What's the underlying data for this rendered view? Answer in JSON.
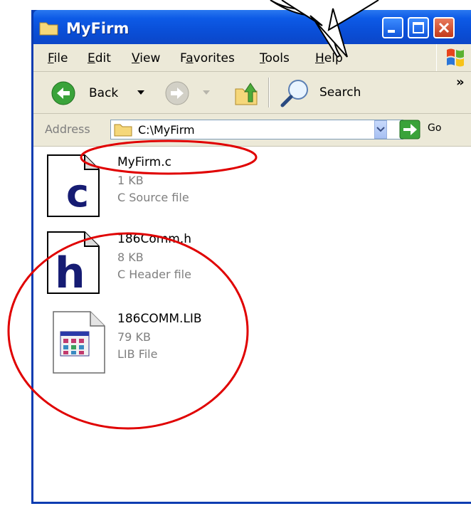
{
  "window": {
    "title": "MyFirm"
  },
  "menu": [
    {
      "pre": "",
      "u": "F",
      "post": "ile"
    },
    {
      "pre": "",
      "u": "E",
      "post": "dit"
    },
    {
      "pre": "",
      "u": "V",
      "post": "iew"
    },
    {
      "pre": "F",
      "u": "a",
      "post": "vorites"
    },
    {
      "pre": "",
      "u": "T",
      "post": "ools"
    },
    {
      "pre": "",
      "u": "H",
      "post": "elp"
    }
  ],
  "toolbar": {
    "back_label": "Back",
    "search_label": "Search",
    "overflow": "»"
  },
  "address": {
    "label": "Address",
    "value": "C:\\MyFirm",
    "go_label": "Go"
  },
  "files": [
    {
      "name": "MyFirm.c",
      "size": "1 KB",
      "type": "C Source file",
      "icon": "c-source-file-icon",
      "letter": "c"
    },
    {
      "name": "186Comm.h",
      "size": "8 KB",
      "type": "C Header file",
      "icon": "c-header-file-icon",
      "letter": "h"
    },
    {
      "name": "186COMM.LIB",
      "size": "79 KB",
      "type": "LIB File",
      "icon": "lib-file-icon",
      "letter": ""
    }
  ],
  "colors": {
    "title_blue": "#0a4fd8",
    "annotation_red": "#e00000",
    "chrome": "#ece9d8"
  }
}
